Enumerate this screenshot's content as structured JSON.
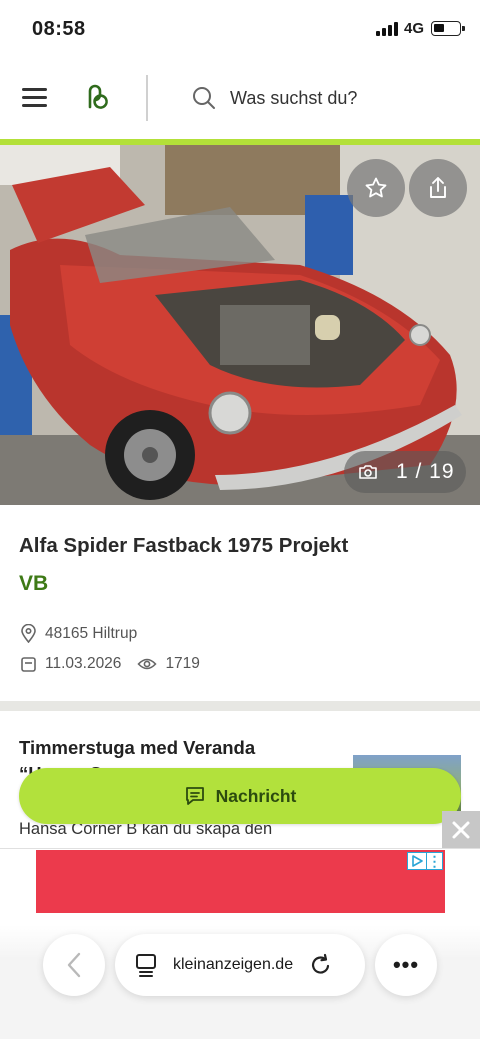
{
  "status_bar": {
    "time": "08:58",
    "network": "4G"
  },
  "header": {
    "search_placeholder": "Was suchst du?"
  },
  "gallery": {
    "counter": "1 / 19"
  },
  "listing": {
    "title": "Alfa Spider Fastback 1975 Projekt",
    "price": "VB",
    "location": "48165 Hiltrup",
    "date": "11.03.2026",
    "views": "1719"
  },
  "recommendation": {
    "title": "Timmerstuga med Veranda “Hansa Corner",
    "description": "Hansa Corner B kan du skapa den"
  },
  "message_button": {
    "label": "Nachricht"
  },
  "browser": {
    "url": "kleinanzeigen.de",
    "more_label": "•••"
  },
  "colors": {
    "brand_green": "#b3e039",
    "price_green": "#3e7a16",
    "ad_red": "#ec3a4c"
  },
  "icons": [
    "menu-icon",
    "logo-icon",
    "search-icon",
    "star-icon",
    "share-icon",
    "camera-icon",
    "location-pin-icon",
    "calendar-icon",
    "eye-icon",
    "chat-icon",
    "close-icon",
    "adchoices-icon",
    "chevron-left-icon",
    "tabs-icon",
    "reload-icon"
  ]
}
